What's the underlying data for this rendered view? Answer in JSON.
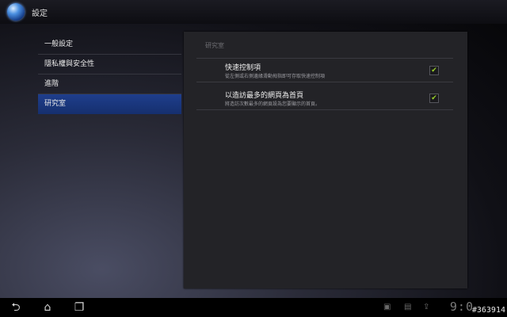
{
  "action_bar": {
    "title": "設定",
    "icon": "globe-icon"
  },
  "menu": {
    "items": [
      {
        "label": "一般設定",
        "selected": false
      },
      {
        "label": "隱私權與安全性",
        "selected": false
      },
      {
        "label": "進階",
        "selected": false
      },
      {
        "label": "研究室",
        "selected": true
      }
    ]
  },
  "panel": {
    "header": "研究室",
    "settings": [
      {
        "title": "快速控制項",
        "description": "從左側或右側邊緣滑動拇指即可存取快速控制項",
        "checked": true
      },
      {
        "title": "以造訪最多的網頁為首頁",
        "description": "將造訪次數最多的網頁設為您要顯示的首頁。",
        "checked": true
      }
    ]
  },
  "system_bar": {
    "back_icon": "back-arrow-icon",
    "home_icon": "home-icon",
    "recent_icon": "recent-apps-icon",
    "clock": "9:0",
    "tag": "#363914"
  },
  "colors": {
    "selected": "#1f3e8c",
    "check": "#9ad12a",
    "panel": "#232327"
  }
}
